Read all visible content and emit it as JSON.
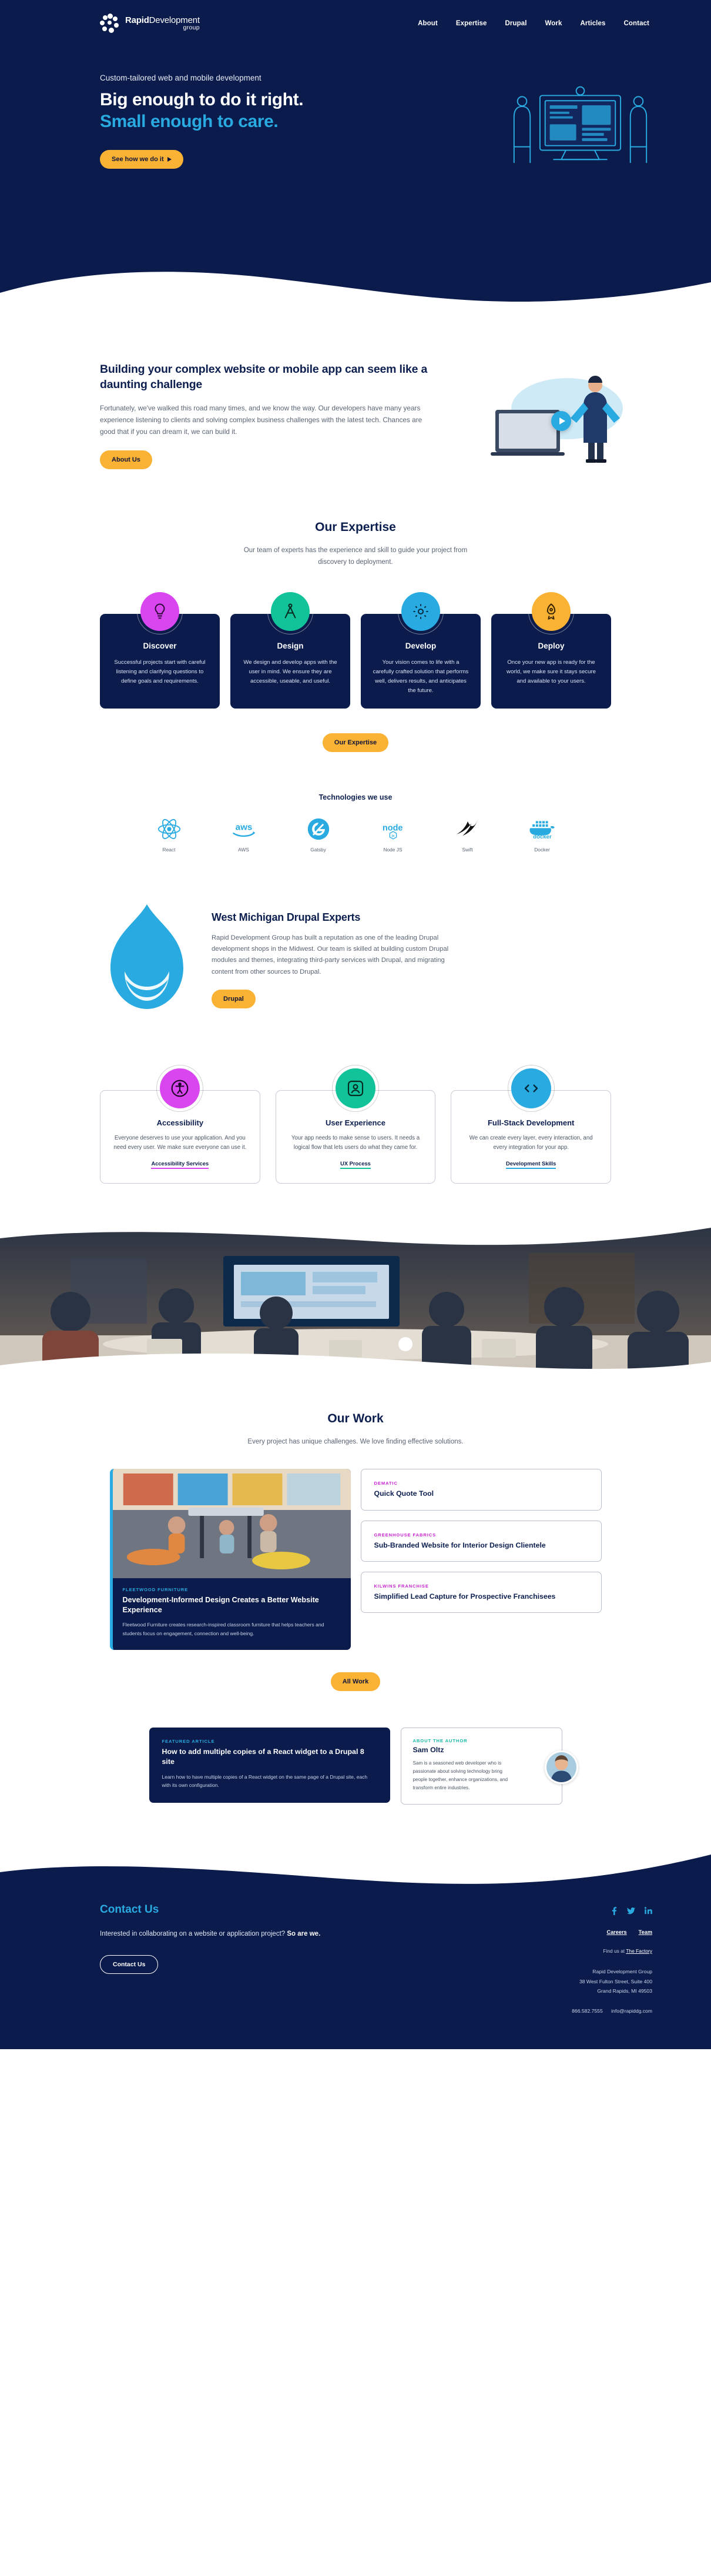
{
  "brand": {
    "name_bold": "Rapid",
    "name_light": "Development",
    "subtitle": "group",
    "logo_icon": "circle-dots-logo"
  },
  "nav": {
    "items": [
      {
        "label": "About"
      },
      {
        "label": "Expertise"
      },
      {
        "label": "Drupal"
      },
      {
        "label": "Work"
      },
      {
        "label": "Articles"
      },
      {
        "label": "Contact"
      }
    ]
  },
  "hero": {
    "eyebrow": "Custom-tailored web and mobile development",
    "title_line1": "Big enough to do it right.",
    "title_line2": "Small enough to care.",
    "cta": "See how we do it",
    "cta_icon": "play-triangle-icon",
    "bg_color": "#0b1b4b",
    "accent_color": "#29abe2"
  },
  "intro": {
    "heading": "Building your complex website or mobile app can seem like a daunting challenge",
    "body": "Fortunately, we've walked this road many times, and we know the way. Our developers have many years experience listening to clients and solving complex business challenges with the latest tech. Chances are good that if you can dream it, we can build it.",
    "cta": "About Us",
    "media_icon": "video-play-icon"
  },
  "expertise": {
    "title": "Our Expertise",
    "subtitle": "Our team of experts has the experience and skill to guide your project from discovery to deployment.",
    "cta": "Our Expertise",
    "cards": [
      {
        "title": "Discover",
        "body": "Successful projects start with careful listening and clarifying questions to define goals and requirements.",
        "icon": "lightbulb-icon",
        "color": "#d946ef"
      },
      {
        "title": "Design",
        "body": "We design and develop apps with the user in mind. We ensure they are accessible, useable, and useful.",
        "icon": "compass-drafting-icon",
        "color": "#12c39a"
      },
      {
        "title": "Develop",
        "body": "Your vision comes to life with a carefully crafted solution that performs well, delivers results, and anticipates the future.",
        "icon": "gear-icon",
        "color": "#29abe2"
      },
      {
        "title": "Deploy",
        "body": "Once your new app is ready for the world, we make sure it stays secure and available to your users.",
        "icon": "rocket-icon",
        "color": "#f9b233"
      }
    ]
  },
  "technologies": {
    "heading": "Technologies we use",
    "items": [
      {
        "name": "React",
        "icon": "react-atom-icon"
      },
      {
        "name": "AWS",
        "icon": "aws-logo-icon"
      },
      {
        "name": "Gatsby",
        "icon": "gatsby-logo-icon"
      },
      {
        "name": "Node JS",
        "icon": "nodejs-logo-icon"
      },
      {
        "name": "Swift",
        "icon": "swift-bird-icon"
      },
      {
        "name": "Docker",
        "icon": "docker-whale-icon"
      }
    ]
  },
  "drupal": {
    "heading": "West Michigan Drupal Experts",
    "body": "Rapid Development Group has built a reputation as one of the leading Drupal development shops in the Midwest. Our team is skilled at building custom Drupal modules and themes, integrating third-party services with Drupal, and migrating content from other sources to Drupal.",
    "cta": "Drupal",
    "logo_icon": "drupal-droplet-icon"
  },
  "services": {
    "cards": [
      {
        "title": "Accessibility",
        "body": "Everyone deserves to use your application. And you need every user. We make sure everyone can use it.",
        "link": "Accessibility Services",
        "icon": "accessibility-person-icon",
        "color": "#d946ef"
      },
      {
        "title": "User Experience",
        "body": "Your app needs to make sense to users. It needs a logical flow that lets users do what they came for.",
        "link": "UX Process",
        "icon": "user-profile-icon",
        "color": "#12c39a"
      },
      {
        "title": "Full-Stack Development",
        "body": "We can create every layer, every interaction, and every integration for your app.",
        "link": "Development Skills",
        "icon": "code-brackets-icon",
        "color": "#29abe2"
      }
    ]
  },
  "photo_band": {
    "alt": "team meeting in conference room",
    "icon": "office-meeting-photo"
  },
  "work": {
    "title": "Our Work",
    "subtitle": "Every project has unique challenges. We love finding effective solutions.",
    "cta": "All Work",
    "feature": {
      "eyebrow": "FLEETWOOD FURNITURE",
      "title": "Development-Informed Design Creates a Better Website Experience",
      "body": "Fleetwood Furniture creates research-inspired classroom furniture that helps teachers and students focus on engagement, connection and well-being.",
      "thumb_icon": "classroom-furniture-photo"
    },
    "items": [
      {
        "eyebrow": "DEMATIC",
        "title": "Quick Quote Tool"
      },
      {
        "eyebrow": "GREENHOUSE FABRICS",
        "title": "Sub-Branded Website for Interior Design Clientele"
      },
      {
        "eyebrow": "KILWINS FRANCHISE",
        "title": "Simplified Lead Capture for Prospective Franchisees"
      }
    ]
  },
  "article": {
    "eyebrow": "FEATURED ARTICLE",
    "title": "How to add multiple copies of a React widget to a Drupal 8 site",
    "body": "Learn how to have multiple copies of a React widget on the same page of a Drupal site, each with its own configuration."
  },
  "author": {
    "eyebrow": "ABOUT THE AUTHOR",
    "name": "Sam Oltz",
    "body": "Sam is a seasoned web developer who is passionate about solving technology bring people together, enhance organizations, and transform entire industries.",
    "avatar_icon": "author-avatar-photo"
  },
  "footer": {
    "title": "Contact Us",
    "body_normal": "Interested in collaborating on a website or application project? ",
    "body_bold": "So are we.",
    "cta": "Contact Us",
    "socials": [
      {
        "name": "facebook-icon",
        "glyph": "f"
      },
      {
        "name": "twitter-icon",
        "glyph": "t"
      },
      {
        "name": "linkedin-icon",
        "glyph": "in"
      }
    ],
    "links": [
      {
        "label": "Careers"
      },
      {
        "label": "Team"
      }
    ],
    "find_us_prefix": "Find us at ",
    "find_us_link": "The Factory",
    "address": [
      "Rapid Development Group",
      "38 West Fulton Street, Suite 400",
      "Grand Rapids, MI 49503"
    ],
    "phone": "866.582.7555",
    "email": "info@rapiddg.com"
  }
}
